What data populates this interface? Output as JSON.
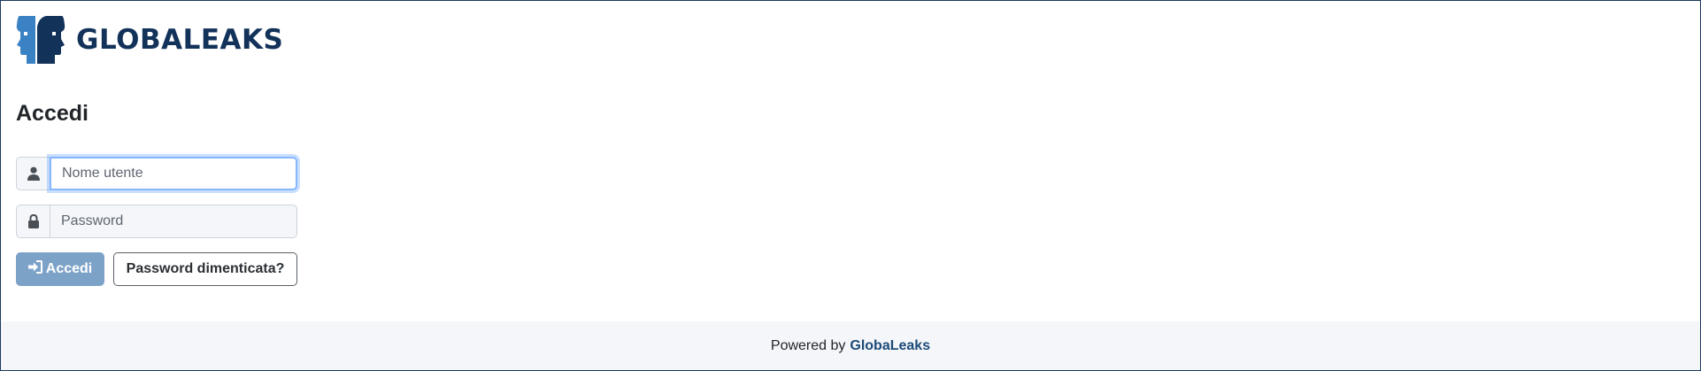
{
  "header": {
    "logo_text": "GLOBALEAKS",
    "logo_icon": "globaleaks-faces-logo"
  },
  "login": {
    "title": "Accedi",
    "username": {
      "placeholder": "Nome utente",
      "value": "",
      "icon": "user-icon"
    },
    "password": {
      "placeholder": "Password",
      "value": "",
      "icon": "lock-icon"
    },
    "login_button": {
      "label": "Accedi",
      "icon": "sign-in-icon"
    },
    "forgot_button": {
      "label": "Password dimenticata?"
    }
  },
  "footer": {
    "powered_by": "Powered by",
    "brand": "GlobaLeaks"
  },
  "colors": {
    "brand_dark": "#12325a",
    "brand_light": "#3b82c4",
    "login_button": "#7da2c8",
    "footer_bg": "#f4f6f9",
    "focus_ring": "#86b7fe"
  }
}
